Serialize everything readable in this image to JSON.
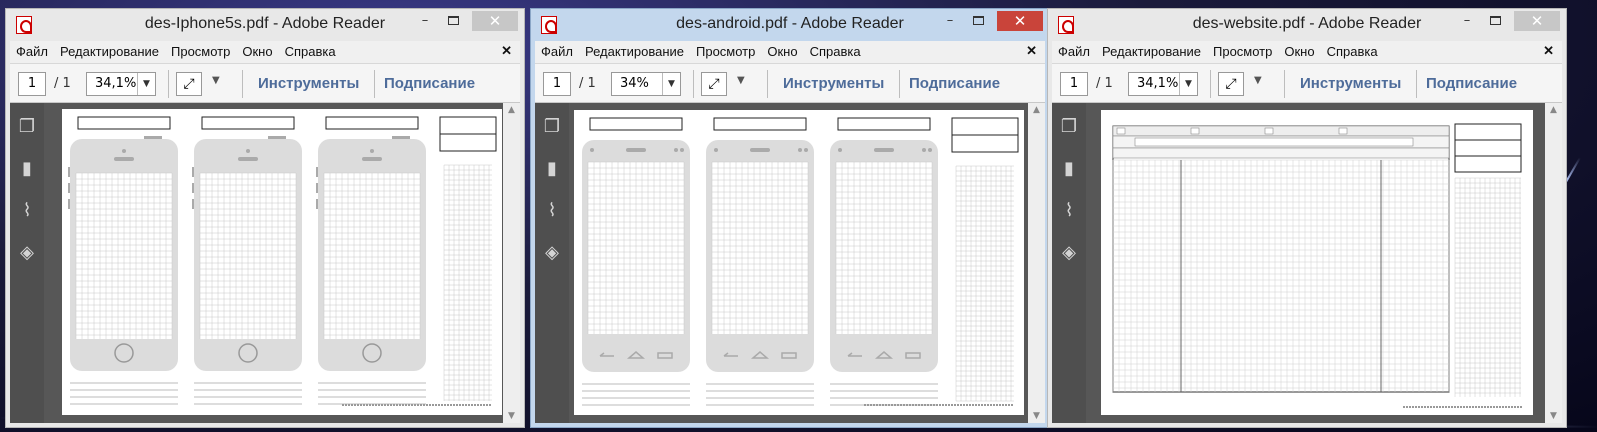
{
  "windows": [
    {
      "title": "des-Iphone5s.pdf - Adobe Reader",
      "menu": [
        "Файл",
        "Редактирование",
        "Просмотр",
        "Окно",
        "Справка"
      ],
      "page_current": "1",
      "page_total": "/ 1",
      "zoom": "34,1%",
      "tools": "Инструменты",
      "sign": "Подписание",
      "device": "iphone",
      "active": false
    },
    {
      "title": "des-android.pdf - Adobe Reader",
      "menu": [
        "Файл",
        "Редактирование",
        "Просмотр",
        "Окно",
        "Справка"
      ],
      "page_current": "1",
      "page_total": "/ 1",
      "zoom": "34%",
      "tools": "Инструменты",
      "sign": "Подписание",
      "device": "android",
      "active": true
    },
    {
      "title": "des-website.pdf - Adobe Reader",
      "menu": [
        "Файл",
        "Редактирование",
        "Просмотр",
        "Окно",
        "Справка"
      ],
      "page_current": "1",
      "page_total": "/ 1",
      "zoom": "34,1%",
      "tools": "Инструменты",
      "sign": "Подписание",
      "device": "website",
      "active": false
    }
  ],
  "window_buttons": {
    "minimize": "–",
    "close": "✕"
  },
  "icons": {
    "pages": "pages-panel-icon",
    "bookmarks": "bookmarks-icon",
    "attachments": "paperclip-icon",
    "layers": "layers-icon",
    "fit": "fit-page-icon",
    "zoom_dropdown": "chevron-down-icon"
  },
  "colors": {
    "link": "#4e6c9a",
    "close_active": "#c9443a",
    "sidebar": "#4f4f4f",
    "viewport": "#575757"
  }
}
